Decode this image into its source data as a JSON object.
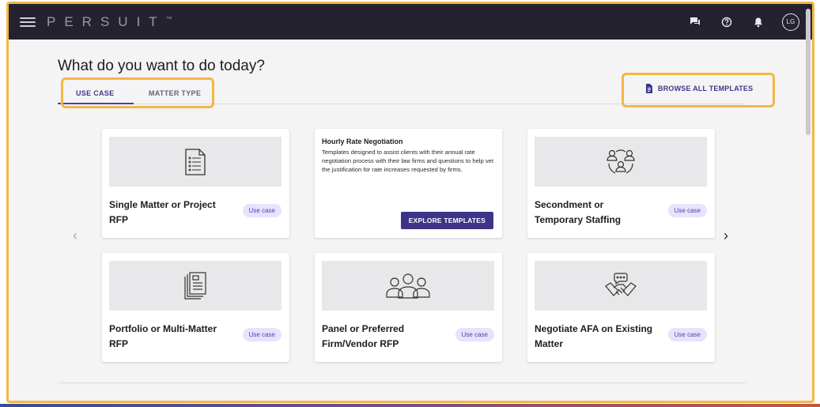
{
  "app": {
    "logo": "PERSUIT",
    "trademark": "™"
  },
  "header": {
    "avatar_initials": "LG"
  },
  "page": {
    "title": "What do you want to do today?"
  },
  "tabs": [
    {
      "label": "USE CASE",
      "active": true
    },
    {
      "label": "MATTER TYPE",
      "active": false
    }
  ],
  "browse": {
    "label": "BROWSE ALL TEMPLATES"
  },
  "cards": [
    {
      "title": "Single Matter or Project RFP",
      "badge": "Use case",
      "icon": "document-list-icon"
    },
    {
      "title": "Hourly Rate Negotiation",
      "description": "Templates designed to assist clients with their annual rate negotiation process with their law firms and questions to help vet the justification for rate increases requested by firms.",
      "button": "EXPLORE TEMPLATES"
    },
    {
      "title": "Secondment or Temporary Staffing",
      "badge": "Use case",
      "icon": "people-cycle-icon"
    },
    {
      "title": "Portfolio or Multi-Matter RFP",
      "badge": "Use case",
      "icon": "stacked-documents-icon"
    },
    {
      "title": "Panel or Preferred Firm/Vendor RFP",
      "badge": "Use case",
      "icon": "group-people-icon"
    },
    {
      "title": "Negotiate AFA on Existing Matter",
      "badge": "Use case",
      "icon": "handshake-icon"
    }
  ],
  "colors": {
    "accent": "#3d3489",
    "highlight": "#f3b645",
    "topbar": "#24222f",
    "pill_bg": "#e6e3fb"
  }
}
